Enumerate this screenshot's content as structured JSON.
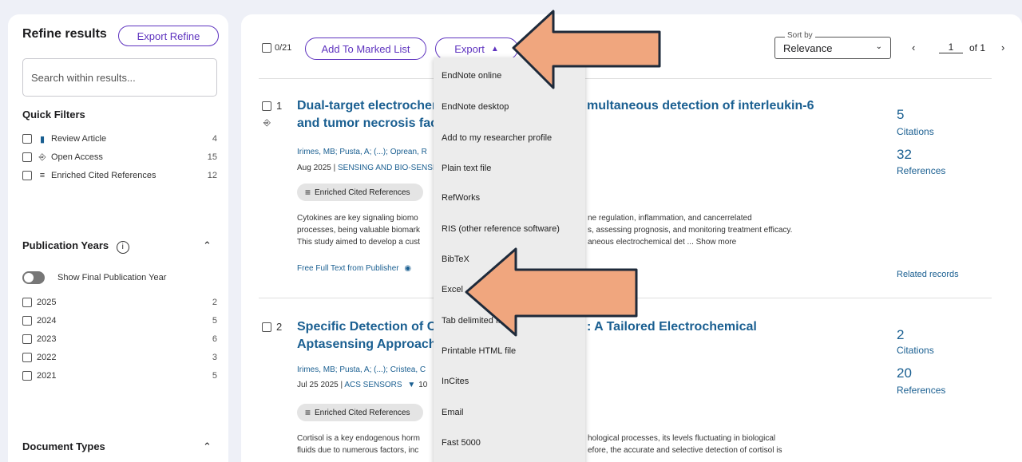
{
  "sidebar": {
    "title": "Refine results",
    "export_refine": "Export Refine",
    "search_placeholder": "Search within results...",
    "quick_filters": {
      "title": "Quick Filters",
      "items": [
        {
          "label": "Review Article",
          "count": "4",
          "icon": "document-icon"
        },
        {
          "label": "Open Access",
          "count": "15",
          "icon": "lock-icon"
        },
        {
          "label": "Enriched Cited References",
          "count": "12",
          "icon": "enriched-list-icon"
        }
      ]
    },
    "publication_years": {
      "title": "Publication Years",
      "toggle_label": "Show Final Publication Year",
      "items": [
        {
          "label": "2025",
          "count": "2"
        },
        {
          "label": "2024",
          "count": "5"
        },
        {
          "label": "2023",
          "count": "6"
        },
        {
          "label": "2022",
          "count": "3"
        },
        {
          "label": "2021",
          "count": "5"
        }
      ]
    },
    "document_types": {
      "title": "Document Types"
    }
  },
  "toolbar": {
    "count": "0/21",
    "add_marked": "Add To Marked List",
    "export": "Export",
    "sort_label": "Sort by",
    "sort_value": "Relevance",
    "page": "1",
    "of_pages": "of 1"
  },
  "export_menu": [
    "EndNote online",
    "EndNote desktop",
    "Add to my researcher profile",
    "Plain text file",
    "RefWorks",
    "RIS (other reference software)",
    "BibTeX",
    "Excel",
    "Tab delimited file",
    "Printable HTML file",
    "InCites",
    "Email",
    "Fast 5000"
  ],
  "records": [
    {
      "num": "1",
      "title_line1": "Dual-target electrochem",
      "title_line1_right": "multaneous detection of interleukin-6",
      "title_line2": "and tumor necrosis fact",
      "authors": "Irimes, MB; Pusta, A; (...); Oprean, R",
      "date": "Aug 2025 | ",
      "journal": "SENSING AND BIO-SENSI",
      "chip": "Enriched Cited References",
      "abstract_left": [
        "Cytokines are key signaling biomo",
        "processes, being valuable biomark",
        "This study aimed to develop a cust"
      ],
      "abstract_right": [
        "ne regulation, inflammation, and cancerrelated",
        "s, assessing prognosis, and monitoring treatment efficacy.",
        "aneous electrochemical det ...  Show more"
      ],
      "fulltext": "Free Full Text from Publisher",
      "citations": "5",
      "citations_label": "Citations",
      "references": "32",
      "references_label": "References",
      "related": "Related records"
    },
    {
      "num": "2",
      "title_line1": "Specific Detection of Co",
      "title_line1_right": ": A Tailored Electrochemical",
      "title_line2": "Aptasensing Approach",
      "authors": "Irimes, MB; Pusta, A; (...); Cristea, C",
      "date": "Jul 25 2025 | ",
      "journal": "ACS SENSORS",
      "journal_extra": "10",
      "chip": "Enriched Cited References",
      "abstract_left": [
        "Cortisol is a key endogenous horm",
        "fluids due to numerous factors, inc"
      ],
      "abstract_right": [
        "hological processes, its levels fluctuating in biological",
        "efore, the accurate and selective detection of cortisol is"
      ],
      "citations": "2",
      "citations_label": "Citations",
      "references": "20",
      "references_label": "References"
    }
  ],
  "colors": {
    "accent": "#5e33bf",
    "link": "#1a5f91",
    "arrow_fill": "#f0a67e"
  }
}
